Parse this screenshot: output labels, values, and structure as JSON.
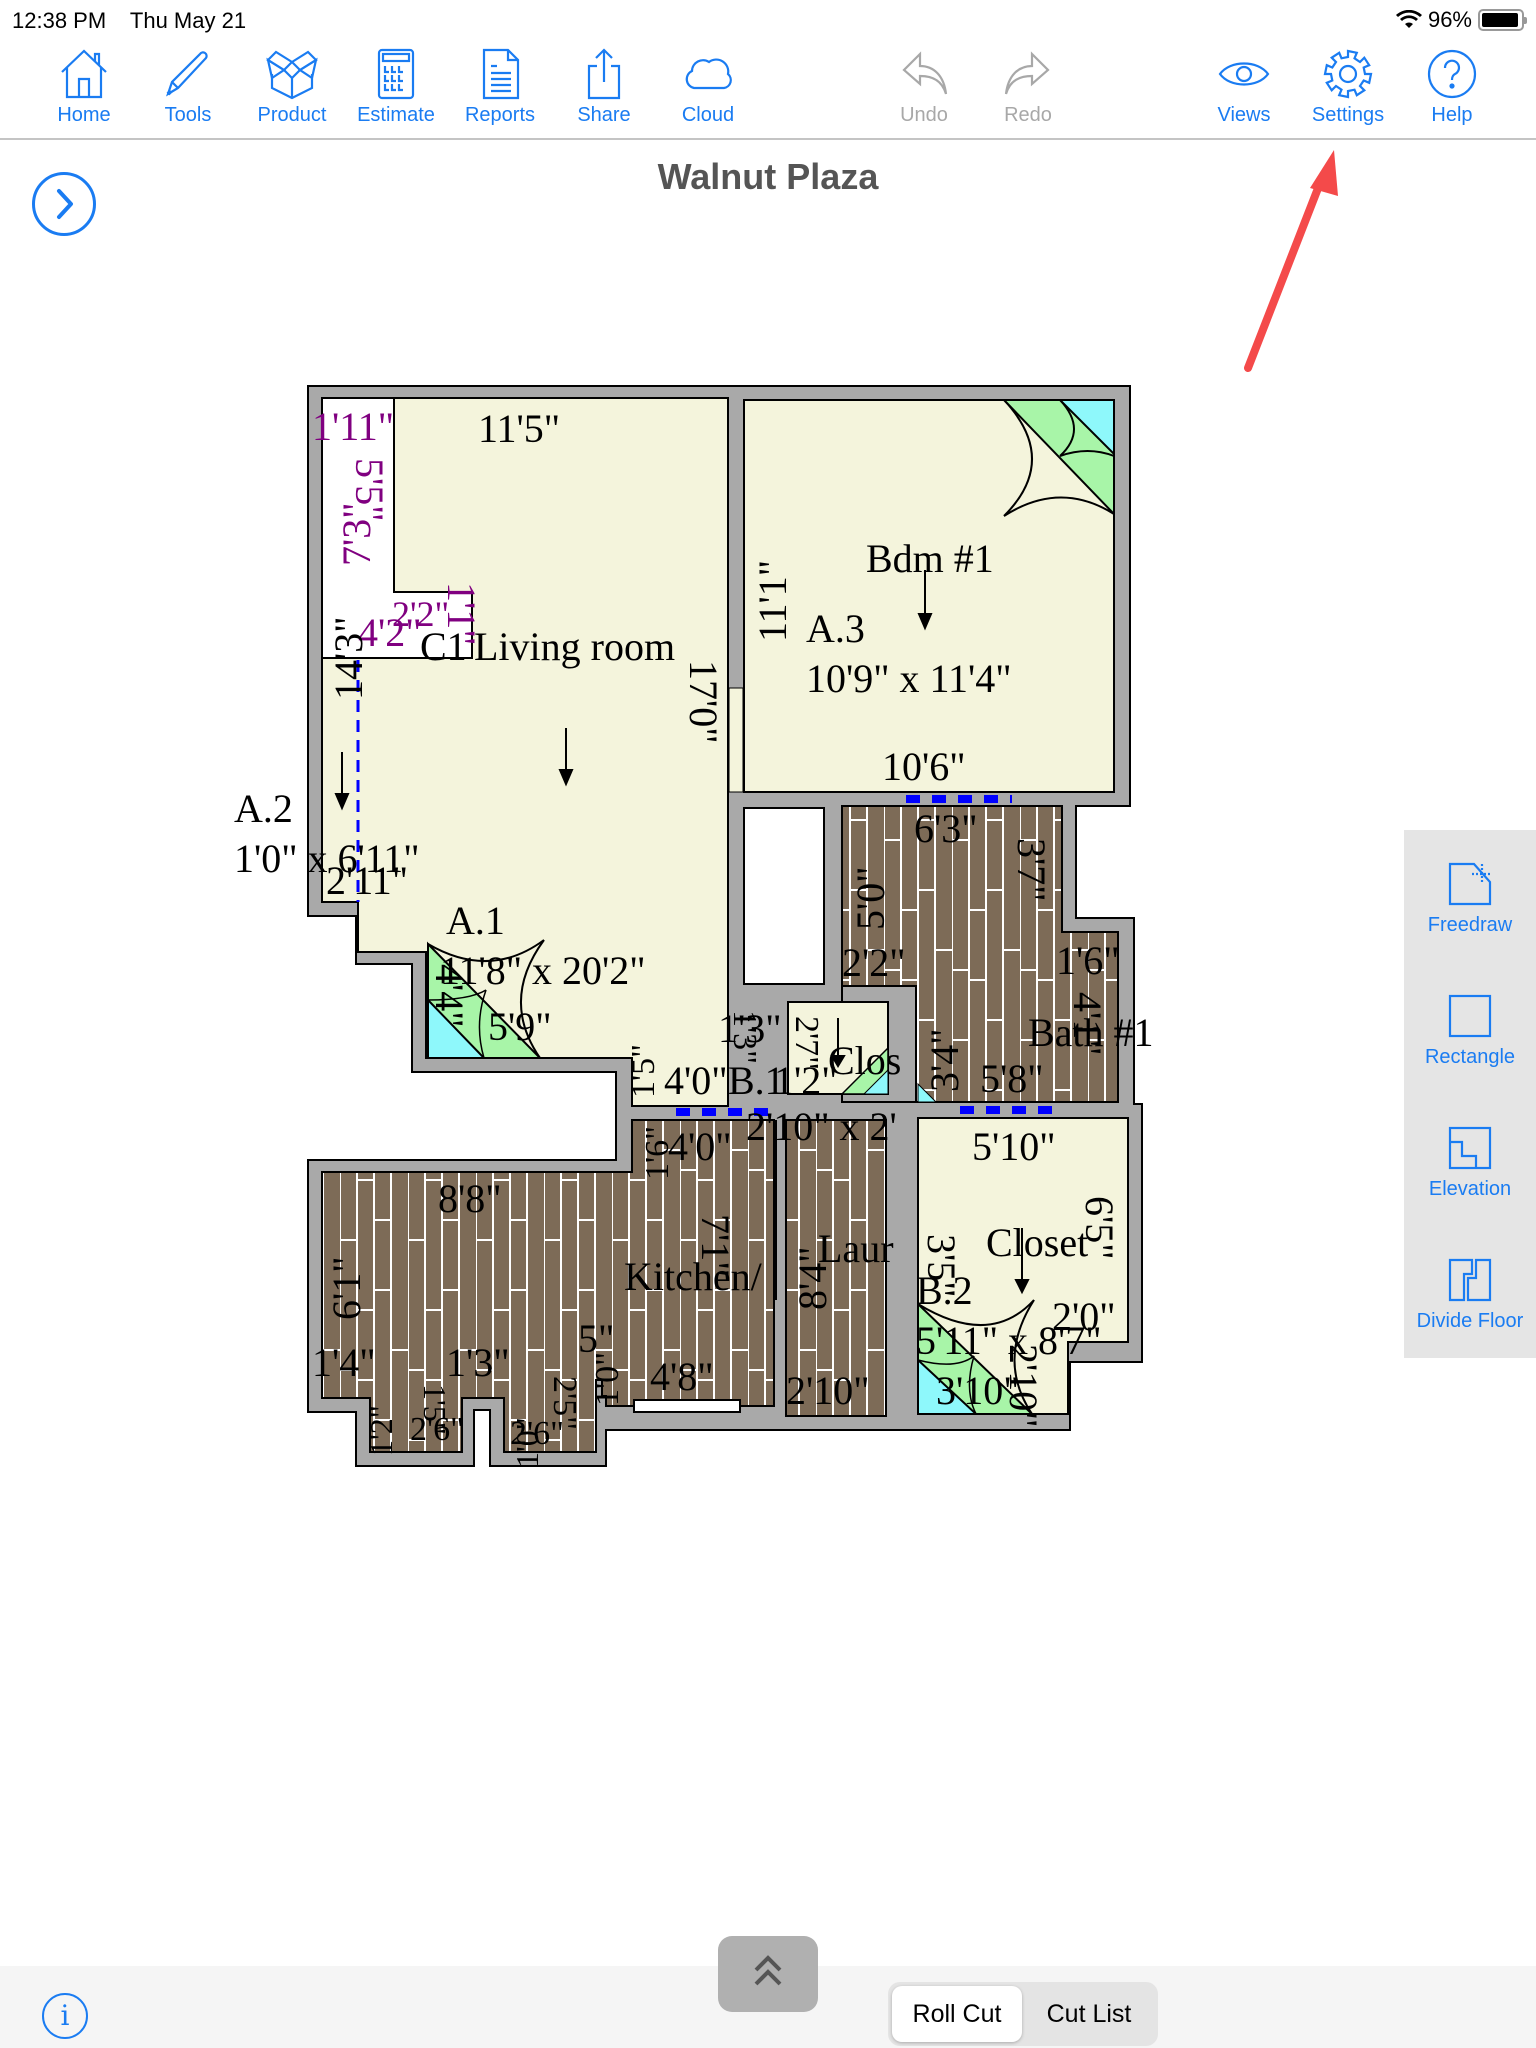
{
  "status_bar": {
    "time": "12:38 PM",
    "date": "Thu May 21",
    "battery_percent": "96%",
    "battery_level": 0.96
  },
  "toolbar": {
    "home": "Home",
    "tools": "Tools",
    "product": "Product",
    "estimate": "Estimate",
    "reports": "Reports",
    "share": "Share",
    "cloud": "Cloud",
    "undo": "Undo",
    "redo": "Redo",
    "views": "Views",
    "settings": "Settings",
    "help": "Help"
  },
  "page": {
    "title": "Walnut Plaza"
  },
  "colors": {
    "accent": "#1a7cf2",
    "disabled": "#a8a8a8",
    "wall": "#a9a9a9",
    "carpet": "#f4f4dc",
    "wood": "#7d6b57",
    "door_green": "#a8f5a8",
    "door_cyan": "#8ef8fb",
    "purple_dim": "#800080",
    "seam_blue": "#0000ff",
    "annotation_red": "#f44a4a"
  },
  "floor_plan": {
    "rooms": {
      "living": {
        "name": "Living room",
        "code": "A.1",
        "size": "11'8\" x 20'2\""
      },
      "closet_small": {
        "code": "A.2",
        "size": "1'0\" x 6'11\""
      },
      "bedroom": {
        "name": "Bdm #1",
        "code": "A.3",
        "size": "10'9\" x 11'4\""
      },
      "kitchen": {
        "name": "Kitchen/"
      },
      "laundry": {
        "name": "Laur"
      },
      "bath": {
        "name": "Bath #1"
      },
      "closet": {
        "name": "Closet",
        "code": "B.2",
        "size": "5'11\" x 8'7\""
      },
      "clos_small": {
        "name": "Clos"
      },
      "b1": {
        "code": "B.1",
        "size": "2'10\" x 2'"
      },
      "c1": {
        "code": "C1"
      }
    },
    "dimensions": {
      "d_1_11": "1'11\"",
      "d_11_5": "11'5\"",
      "d_5_5": "5'5\"",
      "d_7_3": "7'3\"",
      "d_2_2p": "2'2\"",
      "d_4_2": "4'2\"",
      "d_1_1": "1'1\"",
      "d_14_3": "14'3\"",
      "d_17_0": "17'0\"",
      "d_11_1": "11'1\"",
      "d_10_6": "10'6\"",
      "d_2_11": "2'11\"",
      "d_4_4": "4'4\"",
      "d_5_9": "5'9\"",
      "d_6_3": "6'3\"",
      "d_3_7": "3'7\"",
      "d_5_0": "5'0\"",
      "d_2_2": "2'2\"",
      "d_1_6": "1'6\"",
      "d_4_1": "4'1\"",
      "d_3_4": "3'4\"",
      "d_5_8": "5'8\"",
      "d_1_3": "1'3\"",
      "d_4_0a": "4'0\"",
      "d_1_5": "1'5\"",
      "d_2_7": "2'7\"",
      "d_1_2": "1'2\"",
      "d_4_0b": "4'0\"",
      "d_1_6b": "1'6\"",
      "d_7_1": "7'1\"",
      "d_8_8": "8'8\"",
      "d_6_1": "6'1\"",
      "d_1_4": "1'4\"",
      "d_1_3b": "1'3\"",
      "d_5in": "5\"",
      "d_4_8": "4'8\"",
      "d_1_0": "1'0\"",
      "d_2_6": "2'6\"",
      "d_2_6b": "2'6\"",
      "d_1_2b": "1'2\"",
      "d_1_5b": "1'5\"",
      "d_1_0b": "1'0\"",
      "d_2_5": "2'5\"",
      "d_8_4": "8'4\"",
      "d_2_10": "2'10\"",
      "d_5_10": "5'10\"",
      "d_6_5": "6'5\"",
      "d_2_0": "2'0\"",
      "d_3_5": "3'5\"",
      "d_3_10": "3'10\"",
      "d_2_10b": "2'10\""
    }
  },
  "side_panel": {
    "freedraw": "Freedraw",
    "rectangle": "Rectangle",
    "elevation": "Elevation",
    "divide_floor": "Divide Floor"
  },
  "bottom_bar": {
    "info": "i",
    "segments": [
      "Roll Cut",
      "Cut List"
    ],
    "selected_segment": "Roll Cut"
  }
}
